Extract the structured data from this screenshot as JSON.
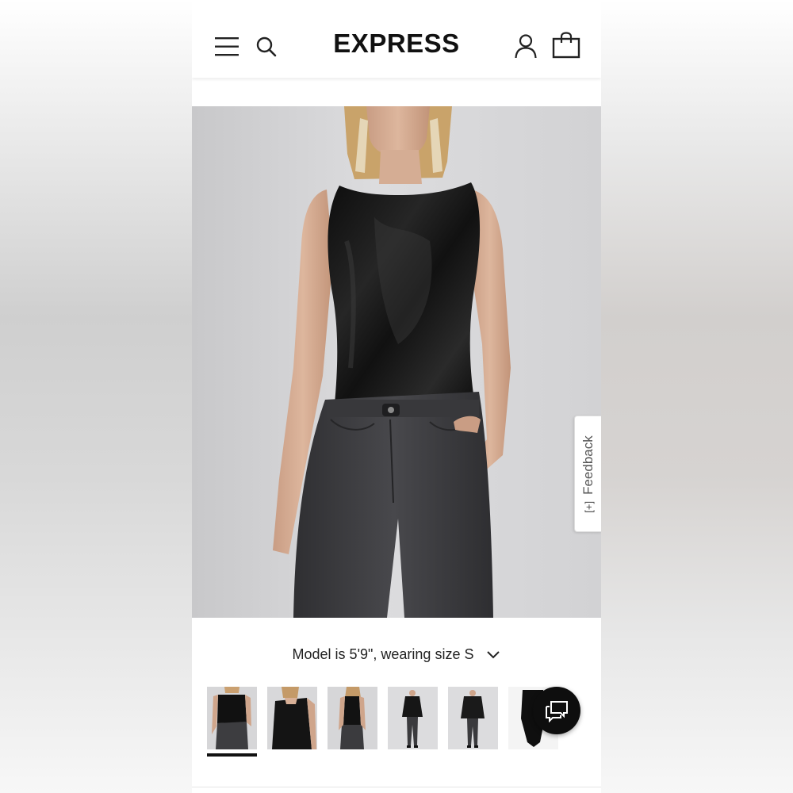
{
  "header": {
    "logo": "EXPRESS",
    "icons": [
      "menu-icon",
      "search-icon",
      "account-icon",
      "shopping-bag-icon"
    ]
  },
  "hero": {
    "feedback_label": "Feedback",
    "feedback_icon": "[+]"
  },
  "product": {
    "model_info": "Model is 5'9\", wearing size S"
  },
  "thumbnails": {
    "count": 6,
    "selected_index": 0
  },
  "chat": {
    "icon": "chat-bubbles-icon"
  },
  "colors": {
    "accent": "#111111",
    "top": "#141414",
    "jeans": "#3a3a3d",
    "backdrop": "#d8d8da"
  }
}
